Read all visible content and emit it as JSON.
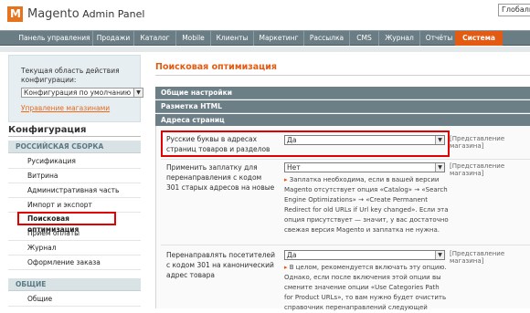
{
  "header": {
    "logo_text": "Magento",
    "panel_text": "Admin Panel",
    "global_search": "Глобаль"
  },
  "nav": {
    "items": [
      "Панель управления",
      "Продажи",
      "Каталог",
      "Mobile",
      "Клиенты",
      "Маркетинг",
      "Рассылка",
      "CMS",
      "Журнал",
      "Отчёты",
      "Система"
    ]
  },
  "sidebar": {
    "scope_label": "Текущая область действия конфигурации:",
    "scope_value": "Конфигурация по умолчанию",
    "manage_stores": "Управление магазинами",
    "config_title": "Конфигурация",
    "group1": "РОССИЙСКАЯ СБОРКА",
    "items1": [
      "Русификация",
      "Витрина",
      "Административная часть",
      "Импорт и экспорт",
      "Поисковая оптимизация",
      "Приём оплаты",
      "Журнал",
      "Оформление заказа"
    ],
    "group2": "ОБЩИЕ",
    "items2": [
      "Общие"
    ]
  },
  "main": {
    "page_title": "Поисковая оптимизация",
    "sections": [
      "Общие настройки",
      "Разметка HTML",
      "Адреса страниц"
    ],
    "rows": [
      {
        "label": "Русские буквы в адресах страниц товаров и разделов",
        "value": "Да",
        "scope": "[Представление магазина]"
      },
      {
        "label": "Применить заплатку для перенаправления с кодом 301 старых адресов на новые",
        "value": "Нет",
        "scope": "[Представление магазина]",
        "note": "Заплатка необходима, если в вашей версии Magento отсутствует опция «Catalog» → «Search Engine Optimizations» → «Create Permanent Redirect for old URLs if Url key changed». Если эта опция присутствует — значит, у вас достаточно свежая версия Magento и заплатка не нужна."
      },
      {
        "label": "Перенаправлять посетителей с кодом 301 на канонический адрес товара",
        "value": "Да",
        "scope": "[Представление магазина]",
        "note": "В целом, рекомендуется включать эту опцию. Однако, если после включения этой опции вы смените значение опции «Use Categories Path for Product URLs», то вам нужно будет очистить справочник перенаправлений следующей"
      }
    ]
  }
}
